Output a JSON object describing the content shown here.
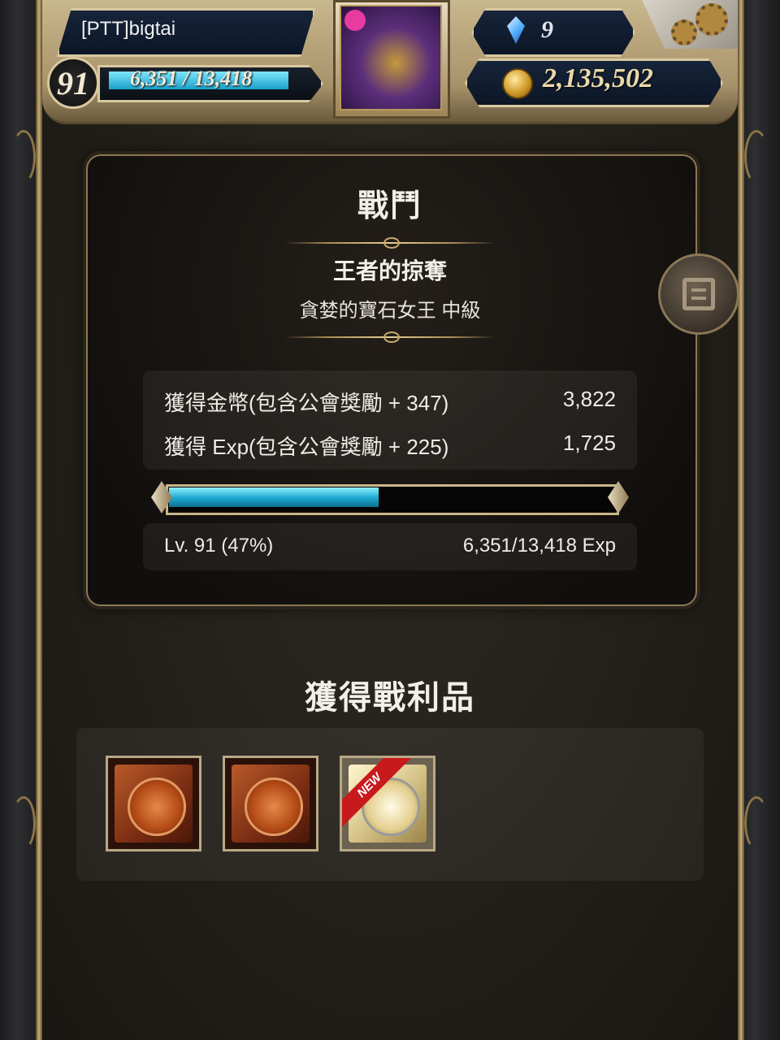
{
  "header": {
    "player_name": "[PTT]bigtai",
    "level": "91",
    "exp_text": "6,351 / 13,418",
    "exp_fraction": 0.47,
    "gems": "9",
    "gold": "2,135,502"
  },
  "battle": {
    "title": "戰鬥",
    "quest_title": "王者的掠奪",
    "quest_subtitle": "貪婪的寶石女王 中級",
    "gold_label": "獲得金幣(包含公會獎勵 + 347)",
    "gold_value": "3,822",
    "exp_label": "獲得 Exp(包含公會獎勵 + 225)",
    "exp_value": "1,725",
    "progress_fraction": 0.47,
    "level_text": "Lv. 91 (47%)",
    "exp_progress_text": "6,351/13,418 Exp"
  },
  "loot": {
    "title": "獲得戰利品",
    "items": [
      {
        "type": "bronze-card",
        "is_new": false
      },
      {
        "type": "bronze-card",
        "is_new": false
      },
      {
        "type": "gold-card",
        "is_new": true,
        "badge": "NEW"
      }
    ]
  },
  "colors": {
    "exp_bar": "#1ba7cf",
    "frame_gold": "#c9b78a",
    "new_badge": "#c8191d"
  }
}
